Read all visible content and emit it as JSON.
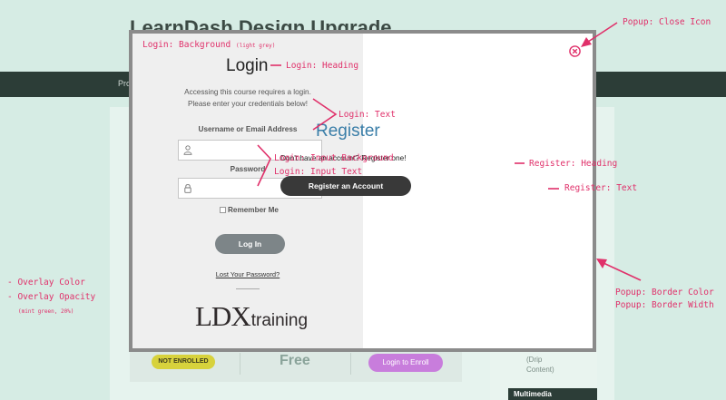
{
  "background": {
    "site_title": "LearnDash Design Upgrade",
    "nav_item": "Pro",
    "status_badge": "NOT ENROLLED",
    "price": "Free",
    "enroll_button": "Login to Enroll",
    "side_text_line1": "(Drip",
    "side_text_line2": "Content)",
    "side_heading": "Multimedia"
  },
  "popup": {
    "login": {
      "heading": "Login",
      "text_line1": "Accessing this course requires a login.",
      "text_line2": "Please enter your credentials below!",
      "username_label": "Username or Email Address",
      "password_label": "Password",
      "remember_label": "Remember Me",
      "login_button": "Log In",
      "lost_password": "Lost Your Password?",
      "logo_ldx": "LDX",
      "logo_training": "training"
    },
    "register": {
      "heading": "Register",
      "text": "Don't have an account? Register one!",
      "button": "Register an Account"
    }
  },
  "annotations": {
    "login_background": "Login: Background",
    "login_background_note": "(light grey)",
    "login_heading": "Login: Heading",
    "login_text": "Login: Text",
    "login_input_background": "Login: Input Background",
    "login_input_text": "Login: Input Text",
    "close_icon": "Popup: Close Icon",
    "register_heading": "Register: Heading",
    "register_text": "Register: Text",
    "overlay_color": "- Overlay Color",
    "overlay_opacity": "- Overlay Opacity",
    "overlay_note": "(mint green, 20%)",
    "border_color": "Popup: Border Color",
    "border_width": "Popup: Border Width"
  },
  "colors": {
    "overlay": "#d6ece4",
    "annotation": "#e0306a",
    "popup_border": "#8b8b8b",
    "login_background": "#efefef",
    "register_heading": "#3a7ea8",
    "register_button": "#393939",
    "login_button": "#7d8588",
    "enroll_button": "#c87ddc",
    "badge": "#d7d23c"
  }
}
